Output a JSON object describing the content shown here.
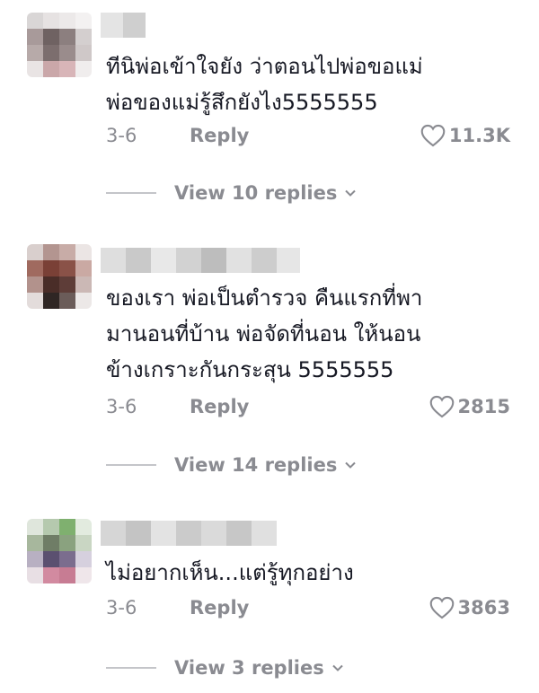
{
  "comments": [
    {
      "text": "ทีนิพ่อเข้าใจยัง ว่าตอนไปพ่อขอแม่\nพ่อของแม่รู้สึกยังไง5555555",
      "date": "3-6",
      "reply_label": "Reply",
      "likes": "11.3K",
      "view_replies": "View 10 replies"
    },
    {
      "text": "ของเรา พ่อเป็นตำรวจ คืนแรกที่พา\nมานอนที่บ้าน พ่อจัดที่นอน ให้นอน\nข้างเกราะกันกระสุน 5555555",
      "date": "3-6",
      "reply_label": "Reply",
      "likes": "2815",
      "view_replies": "View 14 replies"
    },
    {
      "text": "ไม่อยากเห็น...แต่รู้ทุกอย่าง",
      "date": "3-6",
      "reply_label": "Reply",
      "likes": "3863",
      "view_replies": "View 3 replies"
    }
  ],
  "icons": {
    "like": "heart-icon",
    "expand": "chevron-down-icon"
  },
  "colors": {
    "text": "#161823",
    "muted": "#8a8b91",
    "divider": "#c4c5c9"
  }
}
